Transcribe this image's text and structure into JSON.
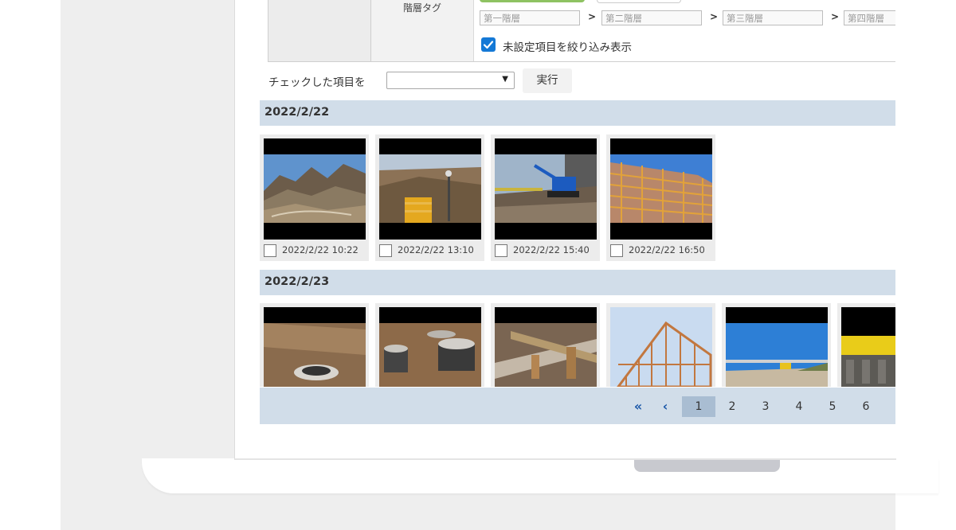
{
  "filter": {
    "tier_tag_label": "階層タグ",
    "tiers": [
      "第一階層",
      "第二階層",
      "第三階層",
      "第四階層"
    ],
    "tier_separator": ">",
    "unset_filter_label": "未設定項目を絞り込み表示",
    "unset_filter_checked": true
  },
  "actions": {
    "checked_items_label": "チェックした項目を",
    "select_value": "",
    "execute_label": "実行"
  },
  "groups": [
    {
      "date": "2022/2/22",
      "photos": [
        {
          "timestamp": "2022/2/22 10:22",
          "subject": "mountain-landscape",
          "checked": false
        },
        {
          "timestamp": "2022/2/22 13:10",
          "subject": "excavation-site",
          "checked": false
        },
        {
          "timestamp": "2022/2/22 15:40",
          "subject": "excavator",
          "checked": false
        },
        {
          "timestamp": "2022/2/22 16:50",
          "subject": "building-scaffolding",
          "checked": false
        }
      ]
    },
    {
      "date": "2022/2/23",
      "photos": [
        {
          "subject": "soil-pipe"
        },
        {
          "subject": "concrete-pipes"
        },
        {
          "subject": "rebar-formwork"
        },
        {
          "subject": "timber-frame"
        },
        {
          "subject": "road-construction"
        },
        {
          "subject": "yellow-machinery"
        }
      ]
    }
  ],
  "pagination": {
    "first_icon": "double-chevron-left-icon",
    "prev_icon": "chevron-left-icon",
    "pages": [
      "1",
      "2",
      "3",
      "4",
      "5",
      "6"
    ],
    "current": "1"
  }
}
